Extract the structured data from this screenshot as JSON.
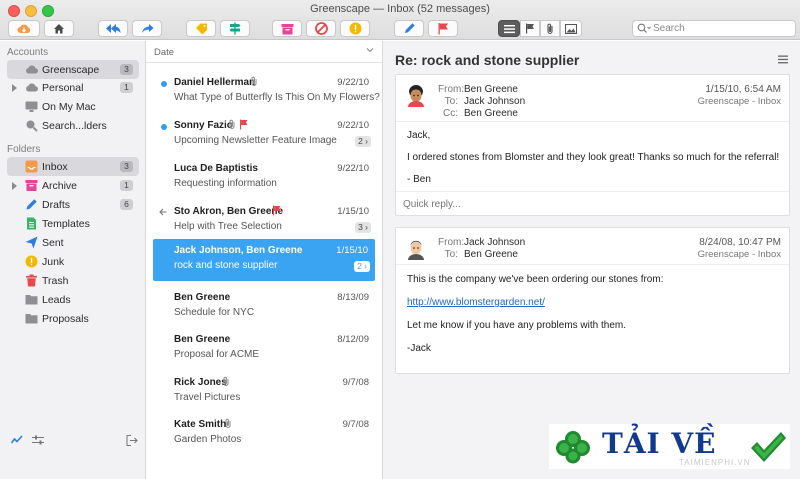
{
  "window": {
    "title": "Greenscape — Inbox (52 messages)"
  },
  "search": {
    "placeholder": "Search"
  },
  "sidebar": {
    "accounts_title": "Accounts",
    "accounts": [
      {
        "label": "Greenscape",
        "count": "3",
        "selected": true,
        "icon": "cloud-icon"
      },
      {
        "label": "Personal",
        "count": "1",
        "icon": "cloud-icon",
        "expandable": true
      },
      {
        "label": "On My Mac",
        "icon": "monitor-icon"
      },
      {
        "label": "Search...lders",
        "icon": "magnifier-icon"
      }
    ],
    "folders_title": "Folders",
    "folders": [
      {
        "label": "Inbox",
        "count": "3",
        "selected": true,
        "color": "#f2994a",
        "icon": "inbox-icon"
      },
      {
        "label": "Archive",
        "count": "1",
        "color": "#e2479b",
        "icon": "archive-icon",
        "expandable": true
      },
      {
        "label": "Drafts",
        "count": "6",
        "color": "#2d7de3",
        "icon": "pencil-icon"
      },
      {
        "label": "Templates",
        "color": "#34b567",
        "icon": "document-icon"
      },
      {
        "label": "Sent",
        "color": "#2d7de3",
        "icon": "paper-plane-icon"
      },
      {
        "label": "Junk",
        "color": "#f5b800",
        "icon": "warning-icon"
      },
      {
        "label": "Trash",
        "color": "#e5484d",
        "icon": "trash-icon"
      },
      {
        "label": "Leads",
        "color": "#8e8e93",
        "icon": "folder-icon"
      },
      {
        "label": "Proposals",
        "color": "#8e8e93",
        "icon": "folder-icon"
      }
    ]
  },
  "message_list": {
    "sort_label": "Date",
    "messages": [
      {
        "sender": "Daniel Hellerman",
        "date": "9/22/10",
        "subject": "What Type of Butterfly Is This On My Flowers?",
        "unread": true,
        "attachment": true
      },
      {
        "sender": "Sonny Fazio",
        "date": "9/22/10",
        "subject": "Upcoming Newsletter Feature Image",
        "unread": true,
        "attachment": true,
        "flagged": true,
        "thread": "2 ›"
      },
      {
        "sender": "Luca De Baptistis",
        "date": "9/22/10",
        "subject": "Requesting information"
      },
      {
        "sender": "Sto Akron, Ben Greene",
        "date": "1/15/10",
        "subject": "Help with Tree Selection",
        "replied": true,
        "flagged": true,
        "thread": "3 ›"
      },
      {
        "sender": "Jack Johnson, Ben Greene",
        "date": "1/15/10",
        "subject": "rock and stone supplier",
        "selected": true,
        "thread": "2 ›"
      },
      {
        "sender": "Ben Greene",
        "date": "8/13/09",
        "subject": "Schedule for NYC"
      },
      {
        "sender": "Ben Greene",
        "date": "8/12/09",
        "subject": "Proposal for ACME"
      },
      {
        "sender": "Rick Jones",
        "date": "9/7/08",
        "subject": "Travel Pictures",
        "attachment": true
      },
      {
        "sender": "Kate Smith",
        "date": "9/7/08",
        "subject": "Garden Photos",
        "attachment": true
      }
    ]
  },
  "reader": {
    "subject": "Re: rock and stone supplier",
    "messages": [
      {
        "from_label": "From:",
        "from": "Ben Greene",
        "to_label": "To:",
        "to": "Jack Johnson",
        "cc_label": "Cc:",
        "cc": "Ben Greene",
        "date": "1/15/10, 6:54 AM",
        "mailbox": "Greenscape - Inbox",
        "body": [
          "Jack,",
          "I ordered stones from Blomster and they look great!  Thanks so much for the referral!",
          "- Ben"
        ],
        "quick_reply_placeholder": "Quick reply..."
      },
      {
        "from_label": "From:",
        "from": "Jack Johnson",
        "to_label": "To:",
        "to": "Ben Greene",
        "date": "8/24/08, 10:47 PM",
        "mailbox": "Greenscape - Inbox",
        "body_intro": "This is the company we've been ordering our stones from:",
        "link": "http://www.blomstergarden.net/",
        "body_rest": [
          "Let me know if you have any problems with them.",
          "-Jack"
        ]
      }
    ]
  },
  "watermark": {
    "text": "TẢI VỀ",
    "sub": "TAIMIENPHI.VN"
  }
}
